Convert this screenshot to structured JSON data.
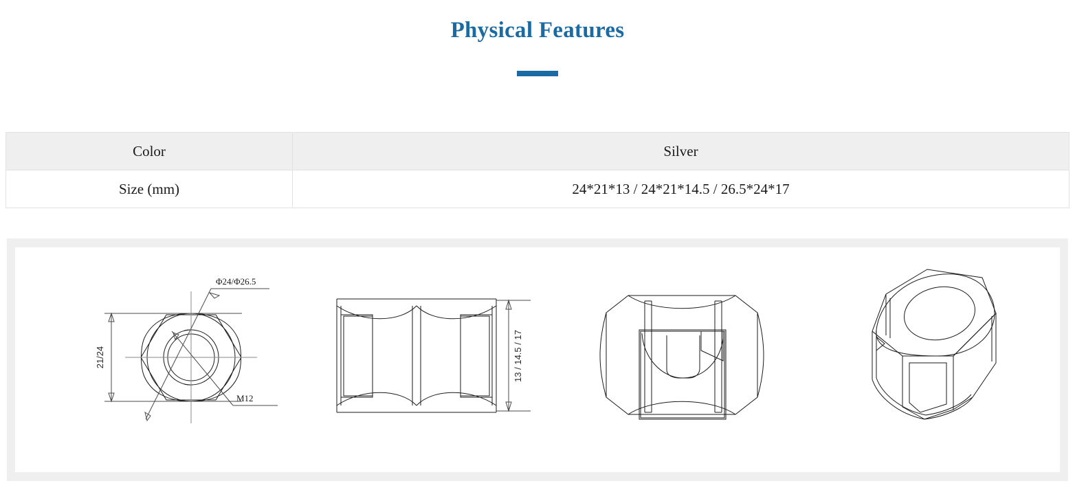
{
  "header": {
    "title": "Physical Features",
    "accent_color": "#1A6AA3",
    "divider": "divider-rule"
  },
  "spec_table": {
    "rows": [
      {
        "label": "Color",
        "value": "Silver"
      },
      {
        "label": "Size (mm)",
        "value": "24*21*13 / 24*21*14.5 / 26.5*24*17"
      }
    ]
  },
  "drawings": {
    "panel_background": "#efefef",
    "figures": [
      {
        "name": "top-view-hexagon",
        "annotations": {
          "outer_diameter": "Φ24/Φ26.5",
          "width_across": "21/24",
          "thread": "M12"
        }
      },
      {
        "name": "front-view",
        "annotations": {
          "height": "13 / 14.5 / 17"
        }
      },
      {
        "name": "section-view",
        "annotations": {}
      },
      {
        "name": "isometric-view",
        "annotations": {}
      }
    ]
  }
}
